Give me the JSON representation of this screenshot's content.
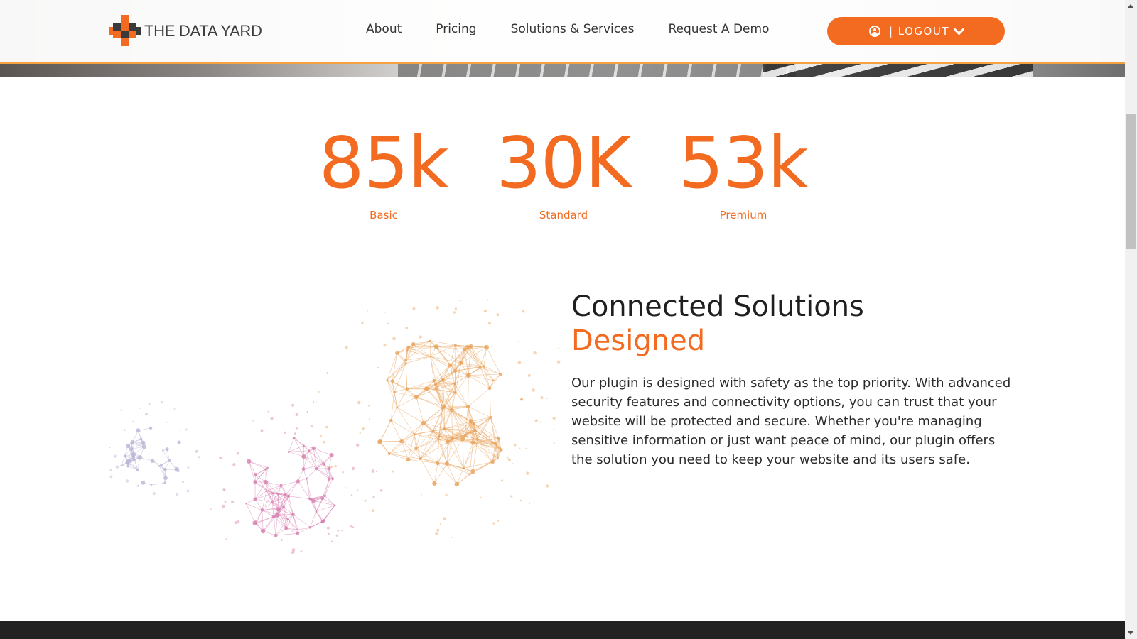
{
  "header": {
    "logo_text": "THE DATA YARD",
    "nav": [
      "About",
      "Pricing",
      "Solutions & Services",
      "Request A Demo"
    ],
    "logout_label": "| LOGOUT"
  },
  "stats": [
    {
      "value": "85k",
      "label": "Basic"
    },
    {
      "value": "30K",
      "label": "Standard"
    },
    {
      "value": "53k",
      "label": "Premium"
    }
  ],
  "section": {
    "heading_line1": "Connected Solutions",
    "heading_line2": "Designed",
    "body": "Our plugin is designed with safety as the top priority. With advanced security features and connectivity options, you can trust that your website will be protected and secure. Whether you're managing sensitive information or just want peace of mind, our plugin offers the solution you need to keep your website and its users safe."
  },
  "colors": {
    "accent": "#f26b21",
    "header_border": "#f5a142",
    "text_dark": "#1f1f1f",
    "footer": "#222223"
  },
  "icons": {
    "user": "user-circle-icon",
    "chevron": "chevron-down-icon"
  }
}
